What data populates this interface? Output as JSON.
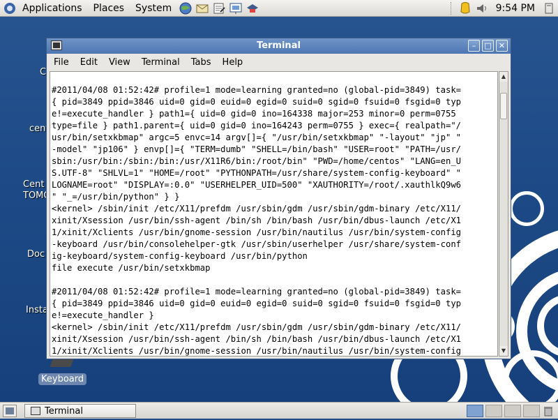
{
  "top_panel": {
    "menus": [
      "Applications",
      "Places",
      "System"
    ],
    "clock": "9:54 PM"
  },
  "desktop": {
    "icon_labels": [
      "C",
      "cent",
      "Cent",
      "TOMC",
      "Doc",
      "Insta"
    ],
    "keyboard_label": "Keyboard"
  },
  "window": {
    "title": "Terminal",
    "menu": [
      "File",
      "Edit",
      "View",
      "Terminal",
      "Tabs",
      "Help"
    ],
    "terminal_lines": [
      "#2011/04/08 01:52:42# profile=1 mode=learning granted=no (global-pid=3849) task=",
      "{ pid=3849 ppid=3846 uid=0 gid=0 euid=0 egid=0 suid=0 sgid=0 fsuid=0 fsgid=0 typ",
      "e!=execute_handler } path1={ uid=0 gid=0 ino=164338 major=253 minor=0 perm=0755 ",
      "type=file } path1.parent={ uid=0 gid=0 ino=164243 perm=0755 } exec={ realpath=\"/",
      "usr/bin/setxkbmap\" argc=5 envc=14 argv[]={ \"/usr/bin/setxkbmap\" \"-layout\" \"jp\" \"",
      "-model\" \"jp106\" } envp[]={ \"TERM=dumb\" \"SHELL=/bin/bash\" \"USER=root\" \"PATH=/usr/",
      "sbin:/usr/bin:/sbin:/bin:/usr/X11R6/bin:/root/bin\" \"PWD=/home/centos\" \"LANG=en_U",
      "S.UTF-8\" \"SHLVL=1\" \"HOME=/root\" \"PYTHONPATH=/usr/share/system-config-keyboard\" \"",
      "LOGNAME=root\" \"DISPLAY=:0.0\" \"USERHELPER_UID=500\" \"XAUTHORITY=/root/.xauthlkQ9w6",
      "\" \"_=/usr/bin/python\" } }",
      "<kernel> /sbin/init /etc/X11/prefdm /usr/sbin/gdm /usr/sbin/gdm-binary /etc/X11/",
      "xinit/Xsession /usr/bin/ssh-agent /bin/sh /bin/bash /usr/bin/dbus-launch /etc/X1",
      "1/xinit/Xclients /usr/bin/gnome-session /usr/bin/nautilus /usr/bin/system-config",
      "-keyboard /usr/bin/consolehelper-gtk /usr/sbin/userhelper /usr/share/system-conf",
      "ig-keyboard/system-config-keyboard /usr/bin/python",
      "file execute /usr/bin/setxkbmap",
      "",
      "#2011/04/08 01:52:42# profile=1 mode=learning granted=no (global-pid=3849) task=",
      "{ pid=3849 ppid=3846 uid=0 gid=0 euid=0 egid=0 suid=0 sgid=0 fsuid=0 fsgid=0 typ",
      "e!=execute_handler }",
      "<kernel> /sbin/init /etc/X11/prefdm /usr/sbin/gdm /usr/sbin/gdm-binary /etc/X11/",
      "xinit/Xsession /usr/bin/ssh-agent /bin/sh /bin/bash /usr/bin/dbus-launch /etc/X1",
      "1/xinit/Xclients /usr/bin/gnome-session /usr/bin/nautilus /usr/bin/system-config"
    ]
  },
  "bottom_panel": {
    "task_label": "Terminal"
  }
}
